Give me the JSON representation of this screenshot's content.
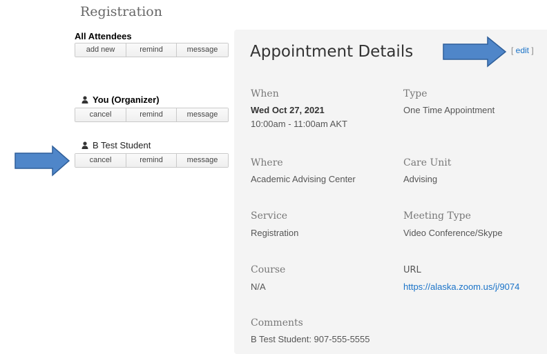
{
  "header": {
    "title": "Registration"
  },
  "attendees": {
    "all": {
      "title": "All Attendees",
      "buttons": [
        "add new",
        "remind",
        "message"
      ]
    },
    "members": [
      {
        "name": "You (Organizer)",
        "buttons": [
          "cancel",
          "remind",
          "message"
        ]
      },
      {
        "name": "B Test Student",
        "buttons": [
          "cancel",
          "remind",
          "message"
        ]
      }
    ]
  },
  "details": {
    "title": "Appointment Details",
    "edit_open": "[ ",
    "edit_label": "edit",
    "edit_close": " ]",
    "when": {
      "label": "When",
      "date": "Wed Oct 27, 2021",
      "time": "10:00am - 11:00am AKT"
    },
    "type": {
      "label": "Type",
      "value": "One Time Appointment"
    },
    "where": {
      "label": "Where",
      "value": "Academic Advising Center"
    },
    "care_unit": {
      "label": "Care Unit",
      "value": "Advising"
    },
    "service": {
      "label": "Service",
      "value": "Registration"
    },
    "meeting_type": {
      "label": "Meeting Type",
      "value": "Video Conference/Skype"
    },
    "course": {
      "label": "Course",
      "value": "N/A"
    },
    "url": {
      "label": "URL",
      "value": "https://alaska.zoom.us/j/9074"
    },
    "comments": {
      "label": "Comments",
      "value": "B Test Student: 907-555-5555"
    }
  },
  "colors": {
    "arrow_fill": "#4f86c9",
    "arrow_stroke": "#2f5f9a",
    "link": "#1a73c8",
    "panel_bg": "#f4f4f4"
  },
  "icons": {
    "person": "person-icon",
    "arrow": "right-arrow-icon"
  }
}
